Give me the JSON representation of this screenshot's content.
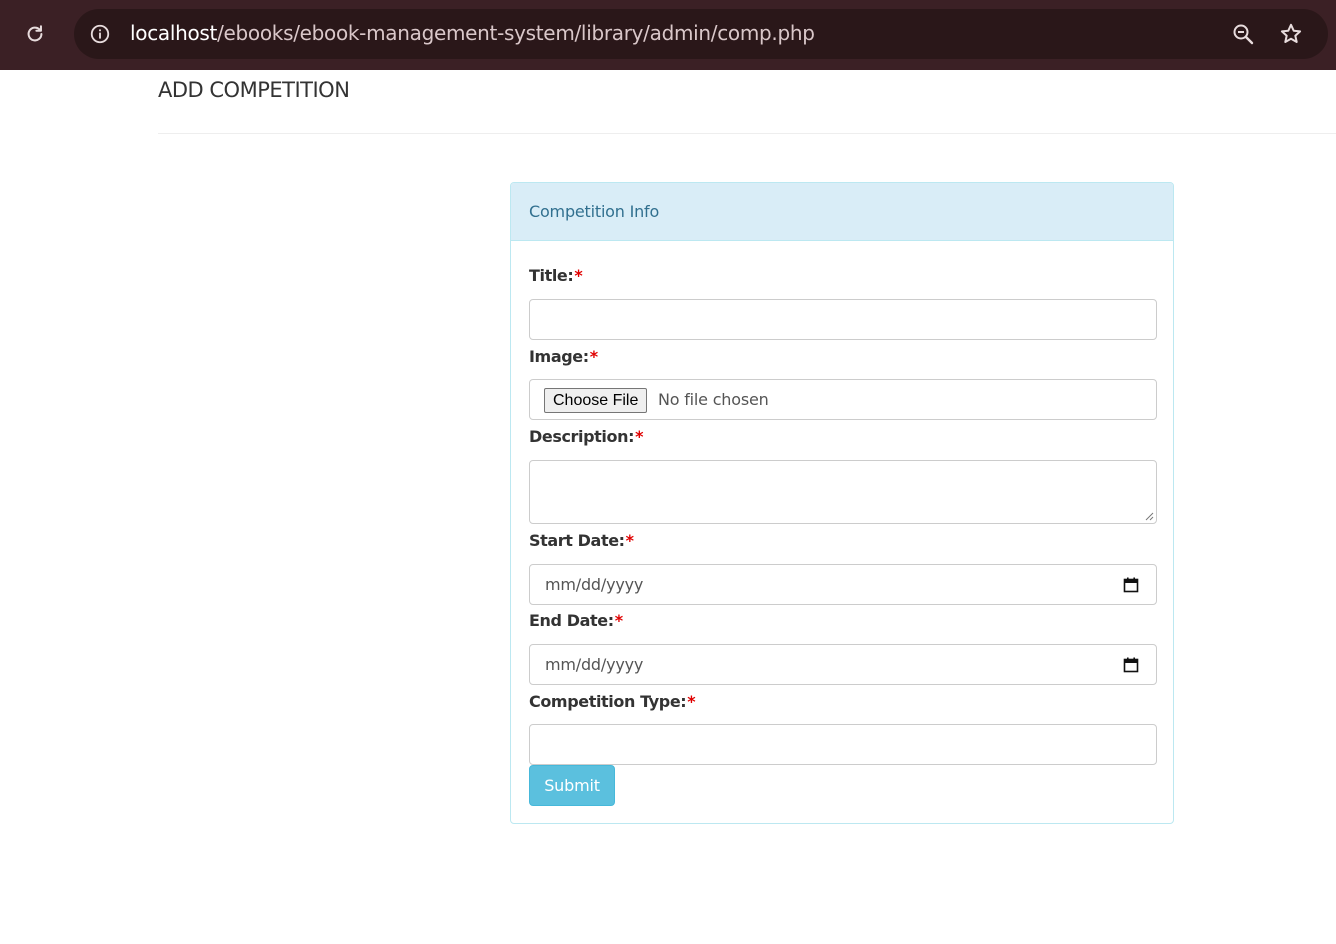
{
  "browser": {
    "url_host": "localhost",
    "url_path": "/ebooks/ebook-management-system/library/admin/comp.php"
  },
  "page": {
    "title": "ADD COMPETITION"
  },
  "panel": {
    "heading": "Competition Info"
  },
  "form": {
    "required_mark": "*",
    "title": {
      "label": "Title:",
      "value": ""
    },
    "image": {
      "label": "Image:",
      "button": "Choose File",
      "status": "No file chosen"
    },
    "description": {
      "label": "Description:",
      "value": ""
    },
    "start_date": {
      "label": "Start Date:",
      "placeholder": "mm/dd/yyyy"
    },
    "end_date": {
      "label": "End Date:",
      "placeholder": "mm/dd/yyyy"
    },
    "competition_type": {
      "label": "Competition Type:",
      "value": ""
    },
    "submit": "Submit"
  },
  "colors": {
    "browser_bar": "#3b2025",
    "panel_heading_bg": "#d9edf7",
    "panel_heading_text": "#31708f",
    "panel_border": "#bce8f1",
    "required": "#e00000",
    "submit_bg": "#5bc0de"
  },
  "icons": {
    "reload": "reload-icon",
    "info": "info-icon",
    "zoom": "zoom-out-icon",
    "bookmark": "star-icon",
    "calendar": "calendar-icon"
  }
}
